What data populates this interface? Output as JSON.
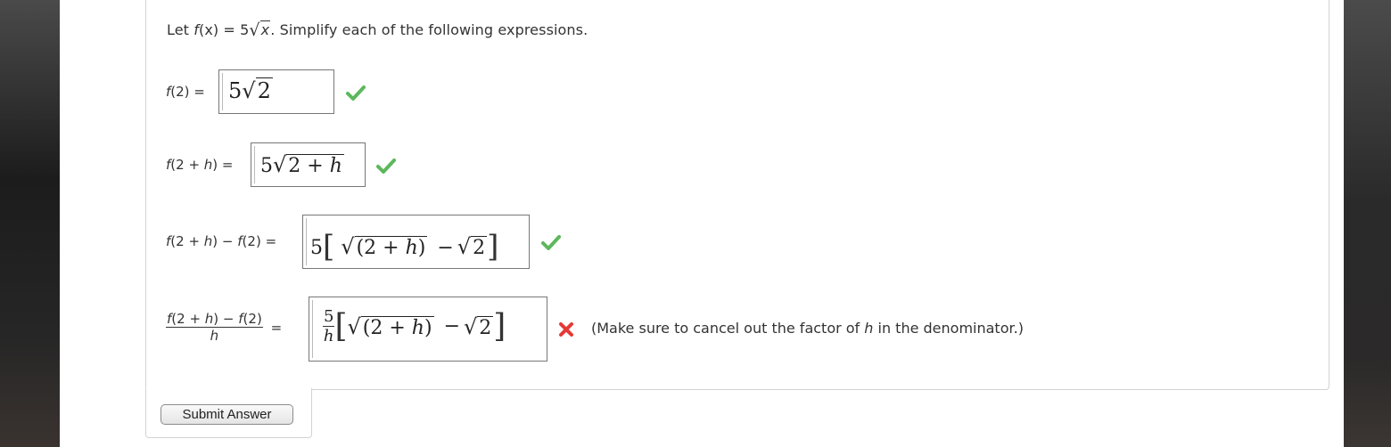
{
  "prompt": {
    "prefix": "Let ",
    "func": "f",
    "arg": "(x)",
    "equals": " = 5",
    "radicand": "x",
    "suffix": ". Simplify each of the following expressions."
  },
  "rows": [
    {
      "label_parts": [
        "f",
        "(2) ="
      ],
      "answer": {
        "coef": "5",
        "radicand": "2"
      },
      "status": "correct"
    },
    {
      "label_parts": [
        "f",
        "(2 + ",
        "h",
        ") ="
      ],
      "answer": {
        "coef": "5",
        "radicand_parts": [
          "2 + ",
          "h"
        ]
      },
      "status": "correct"
    },
    {
      "label_parts": [
        "f",
        "(2 + ",
        "h",
        ") − ",
        "f",
        "(2) ="
      ],
      "answer": {
        "coef": "5",
        "lbracket": "[",
        "rad1_parts": [
          "(2 + ",
          "h",
          ")"
        ],
        "minus": "−",
        "rad2": "2",
        "rbracket": "]"
      },
      "status": "correct"
    },
    {
      "label_num_parts": [
        "f",
        "(2 + ",
        "h",
        ") − ",
        "f",
        "(2)"
      ],
      "label_den": "h",
      "label_eq": "=",
      "answer": {
        "frac_num": "5",
        "frac_den": "h",
        "lbracket": "[",
        "rad1_parts": [
          "(2 + ",
          "h",
          ")"
        ],
        "minus": "−",
        "rad2": "2",
        "rbracket": "]"
      },
      "status": "incorrect",
      "feedback_parts": [
        "(Make sure to cancel out the factor of ",
        "h",
        " in the denominator.)"
      ]
    }
  ],
  "submit_label": "Submit Answer",
  "colors": {
    "correct": "#5cb85c",
    "incorrect": "#e53935"
  },
  "icons": {
    "correct": "check-icon",
    "incorrect": "x-icon"
  }
}
